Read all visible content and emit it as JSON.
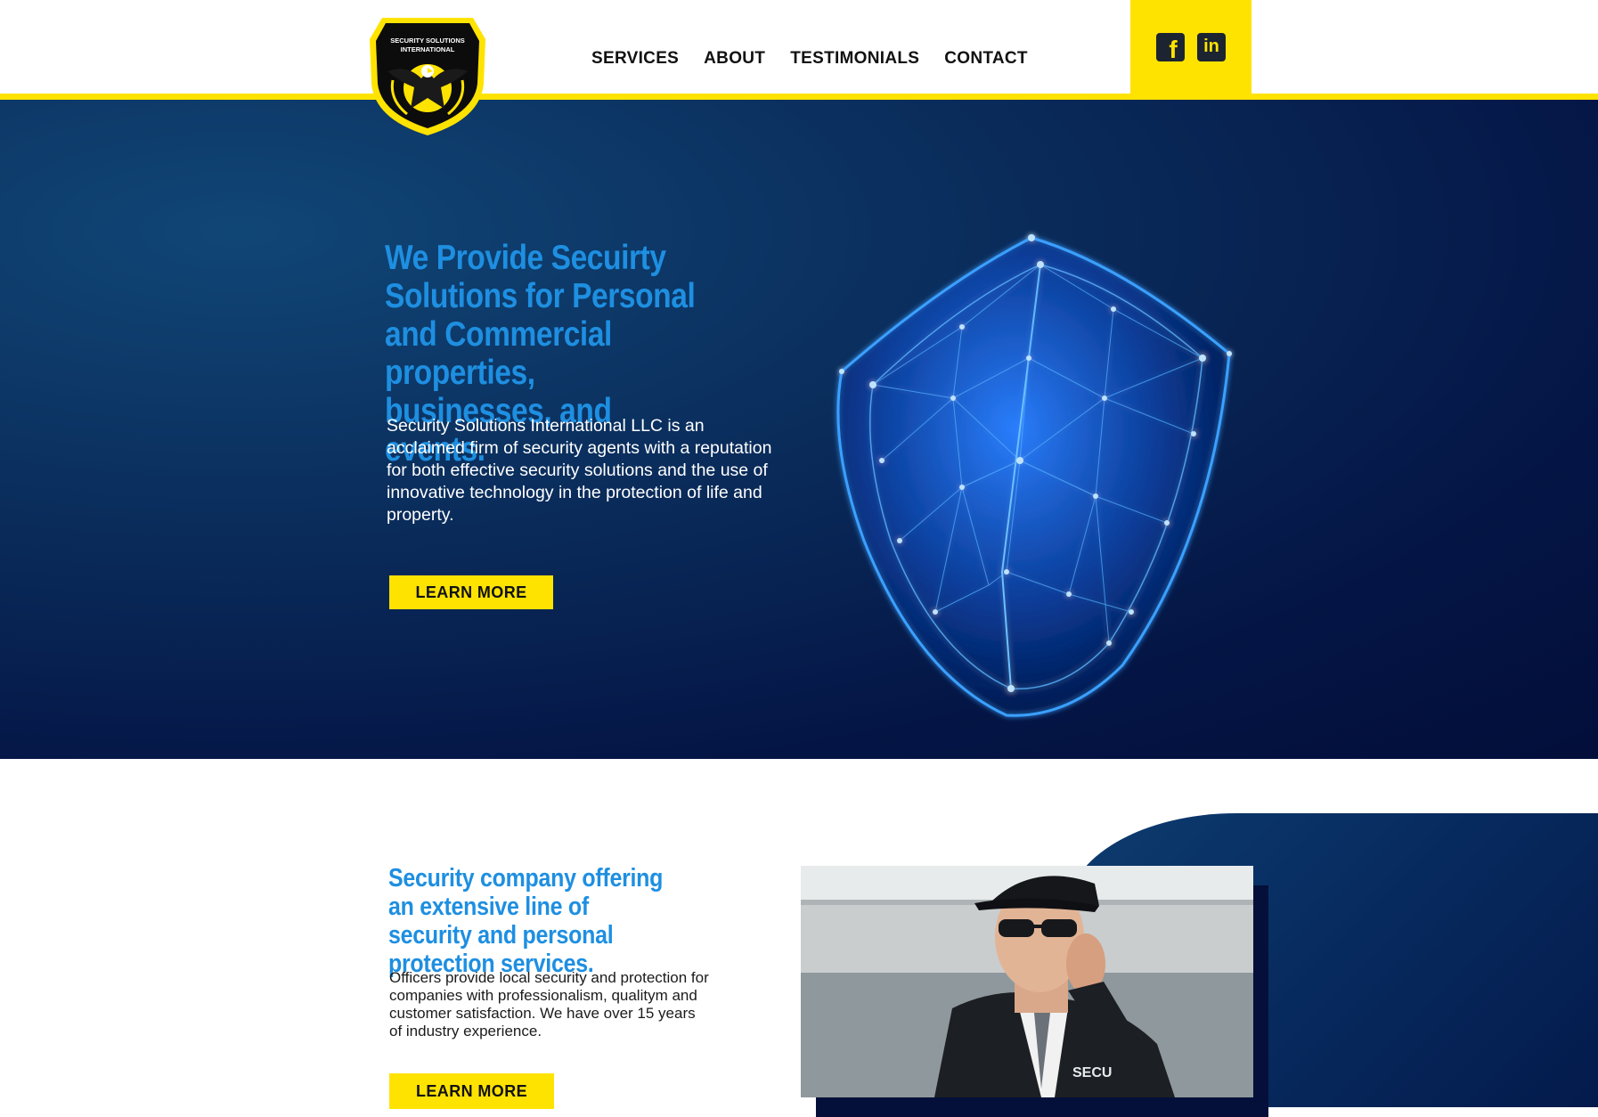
{
  "logo": {
    "line1": "SECURITY SOLUTIONS",
    "line2": "INTERNATIONAL"
  },
  "nav": {
    "items": [
      {
        "label": "SERVICES"
      },
      {
        "label": "ABOUT"
      },
      {
        "label": "TESTIMONIALS"
      },
      {
        "label": "CONTACT"
      }
    ]
  },
  "social": {
    "facebook_glyph": "f",
    "linkedin_glyph": "in",
    "icons": [
      "facebook-icon",
      "linkedin-icon"
    ]
  },
  "hero": {
    "title": "We Provide Secuirty Solutions for Personal and Commercial properties, businesses, and events.",
    "text": "Security Solutions International LLC is an acclaimed firm of security agents with a reputation for both effective security solutions and the use of innovative technology in the protection of life and property.",
    "button": "LEARN MORE"
  },
  "section2": {
    "title": "Security company offering an extensive line of security and personal protection services.",
    "text": "Officers provide local security and protection for companies with professionalism, qualitym and customer satisfaction. We have over 15 years of industry experience.",
    "button": "LEARN MORE",
    "photo_badge": "SECU"
  },
  "colors": {
    "accent_yellow": "#ffe300",
    "title_blue": "#1e8fe1",
    "hero_navy": "#041545"
  }
}
